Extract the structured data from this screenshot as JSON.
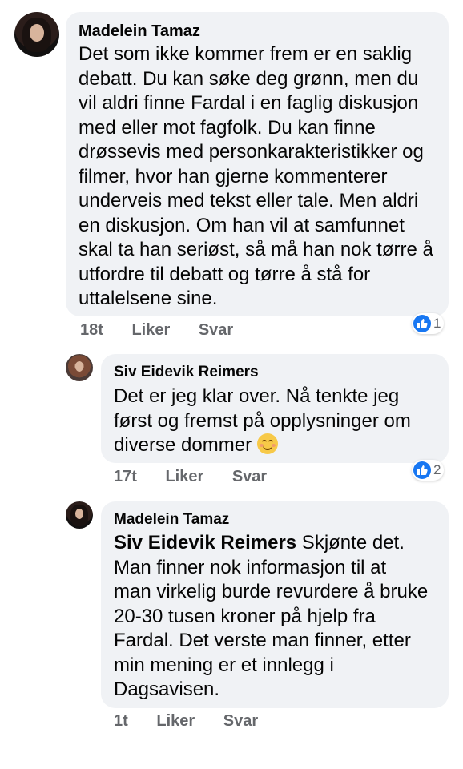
{
  "comments": [
    {
      "author": "Madelein Tamaz",
      "lines": [
        "Det som ikke kommer frem er en saklig",
        "debatt. Du kan søke deg grønn, men du",
        "vil aldri finne Fardal i en faglig diskusjon",
        "med eller mot fagfolk. Du kan finne",
        "drøssevis med personkarakteristikker og",
        "filmer, hvor han gjerne kommenterer",
        "underveis med tekst eller tale. Men aldri",
        "en diskusjon. Om han vil at samfunnet",
        "skal ta han seriøst, så må han nok tørre å",
        "utfordre til debatt og tørre å stå for",
        "uttalelsene sine."
      ],
      "time": "18t",
      "like_label": "Liker",
      "reply_label": "Svar",
      "reaction_icon": "like-icon",
      "reaction_count": "1"
    },
    {
      "author": "Siv Eidevik Reimers",
      "lines": [
        "Det er jeg klar over. Nå tenkte jeg",
        "først og fremst på opplysninger om",
        "diverse dommer"
      ],
      "emoji": "smiling-face-icon",
      "time": "17t",
      "like_label": "Liker",
      "reply_label": "Svar",
      "reaction_icon": "like-icon",
      "reaction_count": "2"
    },
    {
      "author": "Madelein Tamaz",
      "mention": "Siv Eidevik Reimers",
      "first_line_rest": " Skjønte det.",
      "lines": [
        "Man finner nok informasjon til at",
        "man virkelig burde revurdere å bruke",
        "20-30 tusen kroner på hjelp fra",
        "Fardal. Det verste man finner, etter",
        "min mening er et innlegg i",
        "Dagsavisen."
      ],
      "time": "1t",
      "like_label": "Liker",
      "reply_label": "Svar"
    }
  ],
  "colors": {
    "bubble": "#f0f2f5",
    "meta_text": "#65676b",
    "like_blue": "#1877f2"
  }
}
